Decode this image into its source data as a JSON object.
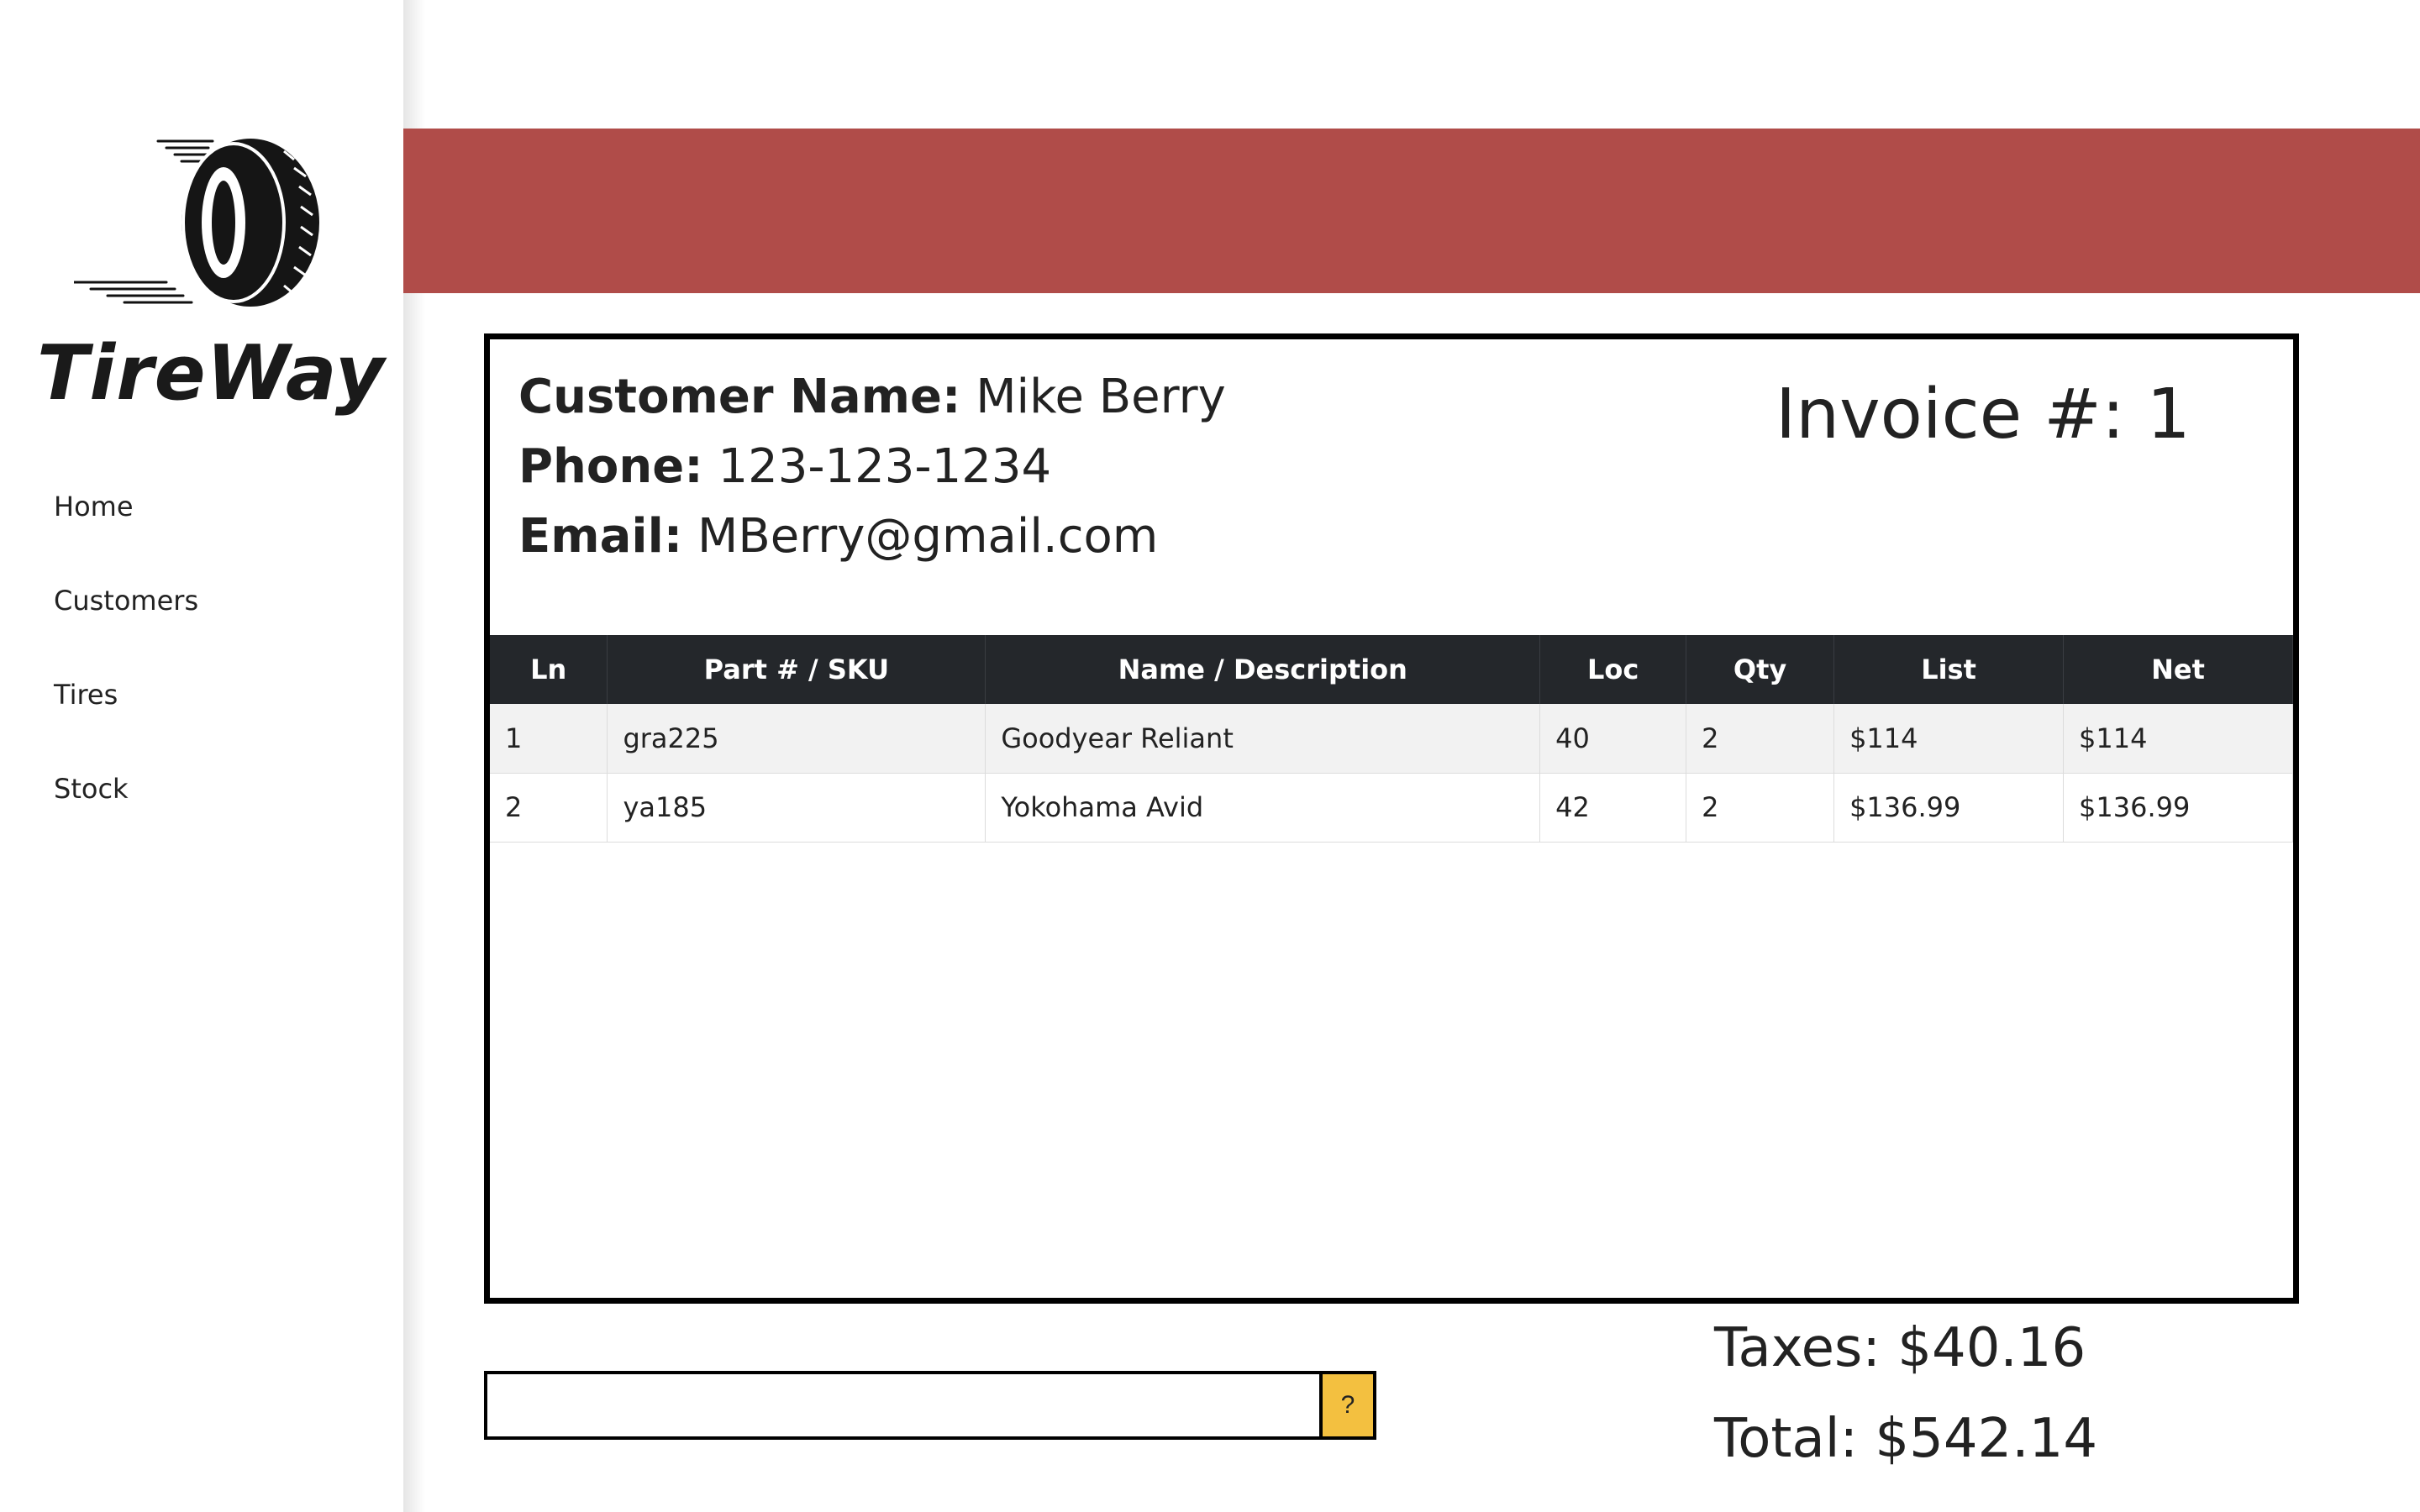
{
  "brand": {
    "name": "TireWay"
  },
  "nav": {
    "items": [
      "Home",
      "Customers",
      "Tires",
      "Stock"
    ]
  },
  "customer": {
    "name_label": "Customer Name:",
    "name_value": "Mike Berry",
    "phone_label": "Phone:",
    "phone_value": "123-123-1234",
    "email_label": "Email:",
    "email_value": "MBerry@gmail.com"
  },
  "invoice": {
    "label": "Invoice #: 1"
  },
  "table": {
    "headers": [
      "Ln",
      "Part # / SKU",
      "Name / Description",
      "Loc",
      "Qty",
      "List",
      "Net"
    ],
    "rows": [
      [
        "1",
        "gra225",
        "Goodyear Reliant",
        "40",
        "2",
        "$114",
        "$114"
      ],
      [
        "2",
        "ya185",
        "Yokohama Avid",
        "42",
        "2",
        "$136.99",
        "$136.99"
      ]
    ]
  },
  "entry": {
    "value": "",
    "help_label": "?"
  },
  "totals": {
    "taxes": "Taxes: $40.16",
    "total": "Total: $542.14"
  },
  "colors": {
    "header_bar": "#b04c49",
    "table_header": "#24272b",
    "help_button": "#f3c040"
  },
  "icons": {
    "logo": "tire-icon"
  }
}
